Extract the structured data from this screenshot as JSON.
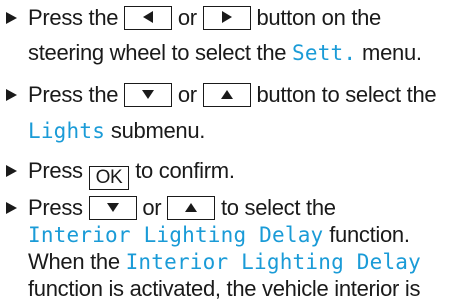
{
  "steps": [
    {
      "lines": [
        {
          "parts": [
            {
              "t": "text",
              "v": "Press the "
            },
            {
              "t": "key",
              "icon": "arrow-left-icon",
              "name": "left-arrow-button"
            },
            {
              "t": "text",
              "v": " or "
            },
            {
              "t": "key",
              "icon": "arrow-right-icon",
              "name": "right-arrow-button"
            },
            {
              "t": "text",
              "v": " button on the"
            }
          ]
        },
        {
          "parts": [
            {
              "t": "text",
              "v": "steering wheel to select the "
            },
            {
              "t": "display",
              "v": "Sett."
            },
            {
              "t": "text",
              "v": " menu."
            }
          ]
        }
      ]
    },
    {
      "lines": [
        {
          "parts": [
            {
              "t": "text",
              "v": "Press the "
            },
            {
              "t": "key",
              "icon": "arrow-down-icon",
              "name": "down-arrow-button"
            },
            {
              "t": "text",
              "v": " or "
            },
            {
              "t": "key",
              "icon": "arrow-up-icon",
              "name": "up-arrow-button"
            },
            {
              "t": "text",
              "v": " button to select the"
            }
          ]
        },
        {
          "parts": [
            {
              "t": "display",
              "v": "Lights"
            },
            {
              "t": "text",
              "v": " submenu."
            }
          ]
        }
      ]
    },
    {
      "lines": [
        {
          "parts": [
            {
              "t": "text",
              "v": "Press "
            },
            {
              "t": "okkey",
              "v": "OK",
              "name": "ok-button"
            },
            {
              "t": "text",
              "v": " to confirm."
            }
          ]
        }
      ]
    },
    {
      "lines": [
        {
          "parts": [
            {
              "t": "text",
              "v": "Press "
            },
            {
              "t": "key",
              "icon": "arrow-down-icon",
              "name": "down-arrow-button"
            },
            {
              "t": "text",
              "v": " or "
            },
            {
              "t": "key",
              "icon": "arrow-up-icon",
              "name": "up-arrow-button"
            },
            {
              "t": "text",
              "v": " to select the"
            }
          ]
        },
        {
          "parts": [
            {
              "t": "display",
              "v": "Interior Lighting Delay"
            },
            {
              "t": "text",
              "v": " function."
            }
          ]
        },
        {
          "parts": [
            {
              "t": "text",
              "v": "When the "
            },
            {
              "t": "display",
              "v": "Interior Lighting Delay"
            }
          ]
        },
        {
          "parts": [
            {
              "t": "text",
              "v": "function is activated, the vehicle interior is"
            }
          ]
        }
      ]
    }
  ],
  "bullet_icon": "triangle-bullet-icon",
  "colors": {
    "text": "#1a1a1a",
    "display_text": "#1a9bd7"
  }
}
